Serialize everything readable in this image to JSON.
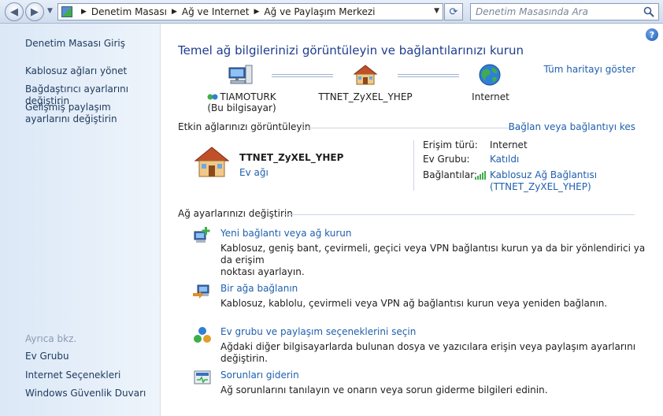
{
  "address": {
    "crumbs": [
      "Denetim Masası",
      "Ağ ve Internet",
      "Ağ ve Paylaşım Merkezi"
    ]
  },
  "search": {
    "placeholder": "Denetim Masasında Ara"
  },
  "sidebar": {
    "items": [
      {
        "label": "Denetim Masası Giriş"
      },
      {
        "label": "Kablosuz ağları yönet"
      },
      {
        "label": "Bağdaştırıcı ayarlarını değiştirin"
      },
      {
        "label": "Gelişmiş paylaşım ayarlarını değiştirin"
      }
    ],
    "see_also_label": "Ayrıca bkz.",
    "see_also": [
      {
        "label": "Ev Grubu"
      },
      {
        "label": "Internet Seçenekleri"
      },
      {
        "label": "Windows Güvenlik Duvarı"
      }
    ]
  },
  "main": {
    "title": "Temel ağ bilgilerinizi görüntüleyin ve bağlantılarınızı kurun",
    "full_map_link": "Tüm haritayı göster",
    "map": {
      "computer_name": "TIAMOTURK",
      "computer_sub": "(Bu bilgisayar)",
      "router_name": "TTNET_ZyXEL_YHEP",
      "internet_name": "Internet"
    },
    "active_header": "Etkin ağlarınızı görüntüleyin",
    "connect_link": "Bağlan veya bağlantıyı kes",
    "network": {
      "name": "TTNET_ZyXEL_YHEP",
      "type": "Ev ağı",
      "access_label": "Erişim türü:",
      "access_value": "Internet",
      "homegroup_label": "Ev Grubu:",
      "homegroup_value": "Katıldı",
      "connections_label": "Bağlantılar:",
      "connections_value_1": "Kablosuz Ağ Bağlantısı",
      "connections_value_2": "(TTNET_ZyXEL_YHEP)"
    },
    "change_header": "Ağ ayarlarınızı değiştirin",
    "tasks": [
      {
        "title": "Yeni bağlantı veya ağ kurun",
        "desc_1": "Kablosuz, geniş bant, çevirmeli, geçici veya VPN bağlantısı kurun ya da bir yönlendirici ya da erişim",
        "desc_2": "noktası ayarlayın."
      },
      {
        "title": "Bir ağa bağlanın",
        "desc_1": "Kablosuz, kablolu, çevirmeli veya VPN ağ bağlantısı kurun veya yeniden bağlanın.",
        "desc_2": ""
      },
      {
        "title": "Ev grubu ve paylaşım seçeneklerini seçin",
        "desc_1": "Ağdaki diğer bilgisayarlarda bulunan dosya ve yazıcılara erişin veya paylaşım ayarlarını değiştirin.",
        "desc_2": ""
      },
      {
        "title": "Sorunları giderin",
        "desc_1": "Ağ sorunlarını tanılayın ve onarın veya sorun giderme bilgileri edinin.",
        "desc_2": ""
      }
    ]
  }
}
